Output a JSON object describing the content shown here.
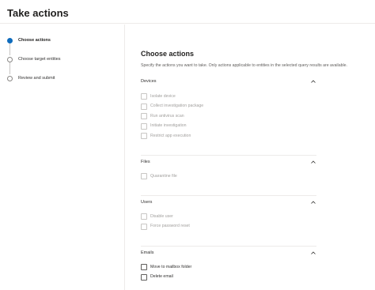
{
  "page": {
    "title": "Take actions"
  },
  "steps": [
    {
      "label": "Choose actions",
      "active": true
    },
    {
      "label": "Choose target entities",
      "active": false
    },
    {
      "label": "Review and submit",
      "active": false
    }
  ],
  "main": {
    "title": "Choose actions",
    "description": "Specify the actions you want to take. Only actions applicable to entities in the selected query results are available."
  },
  "groups": {
    "devices": {
      "title": "Devices",
      "items": [
        {
          "label": "Isolate device",
          "enabled": false
        },
        {
          "label": "Collect investigation package",
          "enabled": false
        },
        {
          "label": "Run antivirus scan",
          "enabled": false
        },
        {
          "label": "Initiate investigation",
          "enabled": false
        },
        {
          "label": "Restrict app execution",
          "enabled": false
        }
      ]
    },
    "files": {
      "title": "Files",
      "items": [
        {
          "label": "Quarantine file",
          "enabled": false
        }
      ]
    },
    "users": {
      "title": "Users",
      "items": [
        {
          "label": "Disable user",
          "enabled": false
        },
        {
          "label": "Force password reset",
          "enabled": false
        }
      ]
    },
    "emails": {
      "title": "Emails",
      "items": [
        {
          "label": "Move to mailbox folder",
          "enabled": true
        },
        {
          "label": "Delete email",
          "enabled": true
        }
      ]
    }
  },
  "colors": {
    "accent": "#0f6cbd",
    "text_primary": "#201f1e",
    "text_disabled": "#a19f9d",
    "divider": "#edebe9"
  },
  "icons": {
    "chevron": "chevron-up-icon",
    "step_marker": "step-circle-icon"
  }
}
